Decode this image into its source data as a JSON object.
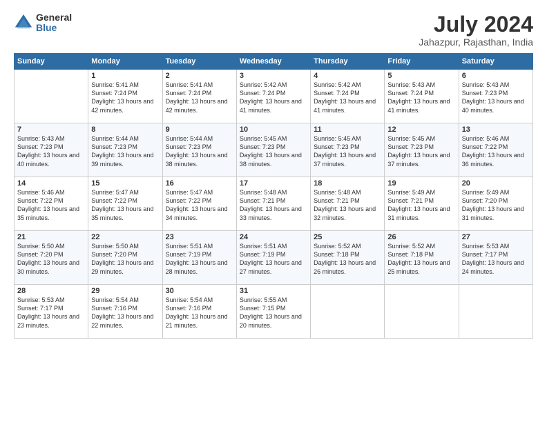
{
  "header": {
    "logo_general": "General",
    "logo_blue": "Blue",
    "month_year": "July 2024",
    "location": "Jahazpur, Rajasthan, India"
  },
  "days_of_week": [
    "Sunday",
    "Monday",
    "Tuesday",
    "Wednesday",
    "Thursday",
    "Friday",
    "Saturday"
  ],
  "weeks": [
    [
      {
        "day": "",
        "sunrise": "",
        "sunset": "",
        "daylight": ""
      },
      {
        "day": "1",
        "sunrise": "5:41 AM",
        "sunset": "7:24 PM",
        "daylight": "13 hours and 42 minutes."
      },
      {
        "day": "2",
        "sunrise": "5:41 AM",
        "sunset": "7:24 PM",
        "daylight": "13 hours and 42 minutes."
      },
      {
        "day": "3",
        "sunrise": "5:42 AM",
        "sunset": "7:24 PM",
        "daylight": "13 hours and 41 minutes."
      },
      {
        "day": "4",
        "sunrise": "5:42 AM",
        "sunset": "7:24 PM",
        "daylight": "13 hours and 41 minutes."
      },
      {
        "day": "5",
        "sunrise": "5:43 AM",
        "sunset": "7:24 PM",
        "daylight": "13 hours and 41 minutes."
      },
      {
        "day": "6",
        "sunrise": "5:43 AM",
        "sunset": "7:23 PM",
        "daylight": "13 hours and 40 minutes."
      }
    ],
    [
      {
        "day": "7",
        "sunrise": "5:43 AM",
        "sunset": "7:23 PM",
        "daylight": "13 hours and 40 minutes."
      },
      {
        "day": "8",
        "sunrise": "5:44 AM",
        "sunset": "7:23 PM",
        "daylight": "13 hours and 39 minutes."
      },
      {
        "day": "9",
        "sunrise": "5:44 AM",
        "sunset": "7:23 PM",
        "daylight": "13 hours and 38 minutes."
      },
      {
        "day": "10",
        "sunrise": "5:45 AM",
        "sunset": "7:23 PM",
        "daylight": "13 hours and 38 minutes."
      },
      {
        "day": "11",
        "sunrise": "5:45 AM",
        "sunset": "7:23 PM",
        "daylight": "13 hours and 37 minutes."
      },
      {
        "day": "12",
        "sunrise": "5:45 AM",
        "sunset": "7:23 PM",
        "daylight": "13 hours and 37 minutes."
      },
      {
        "day": "13",
        "sunrise": "5:46 AM",
        "sunset": "7:22 PM",
        "daylight": "13 hours and 36 minutes."
      }
    ],
    [
      {
        "day": "14",
        "sunrise": "5:46 AM",
        "sunset": "7:22 PM",
        "daylight": "13 hours and 35 minutes."
      },
      {
        "day": "15",
        "sunrise": "5:47 AM",
        "sunset": "7:22 PM",
        "daylight": "13 hours and 35 minutes."
      },
      {
        "day": "16",
        "sunrise": "5:47 AM",
        "sunset": "7:22 PM",
        "daylight": "13 hours and 34 minutes."
      },
      {
        "day": "17",
        "sunrise": "5:48 AM",
        "sunset": "7:21 PM",
        "daylight": "13 hours and 33 minutes."
      },
      {
        "day": "18",
        "sunrise": "5:48 AM",
        "sunset": "7:21 PM",
        "daylight": "13 hours and 32 minutes."
      },
      {
        "day": "19",
        "sunrise": "5:49 AM",
        "sunset": "7:21 PM",
        "daylight": "13 hours and 31 minutes."
      },
      {
        "day": "20",
        "sunrise": "5:49 AM",
        "sunset": "7:20 PM",
        "daylight": "13 hours and 31 minutes."
      }
    ],
    [
      {
        "day": "21",
        "sunrise": "5:50 AM",
        "sunset": "7:20 PM",
        "daylight": "13 hours and 30 minutes."
      },
      {
        "day": "22",
        "sunrise": "5:50 AM",
        "sunset": "7:20 PM",
        "daylight": "13 hours and 29 minutes."
      },
      {
        "day": "23",
        "sunrise": "5:51 AM",
        "sunset": "7:19 PM",
        "daylight": "13 hours and 28 minutes."
      },
      {
        "day": "24",
        "sunrise": "5:51 AM",
        "sunset": "7:19 PM",
        "daylight": "13 hours and 27 minutes."
      },
      {
        "day": "25",
        "sunrise": "5:52 AM",
        "sunset": "7:18 PM",
        "daylight": "13 hours and 26 minutes."
      },
      {
        "day": "26",
        "sunrise": "5:52 AM",
        "sunset": "7:18 PM",
        "daylight": "13 hours and 25 minutes."
      },
      {
        "day": "27",
        "sunrise": "5:53 AM",
        "sunset": "7:17 PM",
        "daylight": "13 hours and 24 minutes."
      }
    ],
    [
      {
        "day": "28",
        "sunrise": "5:53 AM",
        "sunset": "7:17 PM",
        "daylight": "13 hours and 23 minutes."
      },
      {
        "day": "29",
        "sunrise": "5:54 AM",
        "sunset": "7:16 PM",
        "daylight": "13 hours and 22 minutes."
      },
      {
        "day": "30",
        "sunrise": "5:54 AM",
        "sunset": "7:16 PM",
        "daylight": "13 hours and 21 minutes."
      },
      {
        "day": "31",
        "sunrise": "5:55 AM",
        "sunset": "7:15 PM",
        "daylight": "13 hours and 20 minutes."
      },
      {
        "day": "",
        "sunrise": "",
        "sunset": "",
        "daylight": ""
      },
      {
        "day": "",
        "sunrise": "",
        "sunset": "",
        "daylight": ""
      },
      {
        "day": "",
        "sunrise": "",
        "sunset": "",
        "daylight": ""
      }
    ]
  ],
  "labels": {
    "sunrise": "Sunrise:",
    "sunset": "Sunset:",
    "daylight": "Daylight: "
  }
}
